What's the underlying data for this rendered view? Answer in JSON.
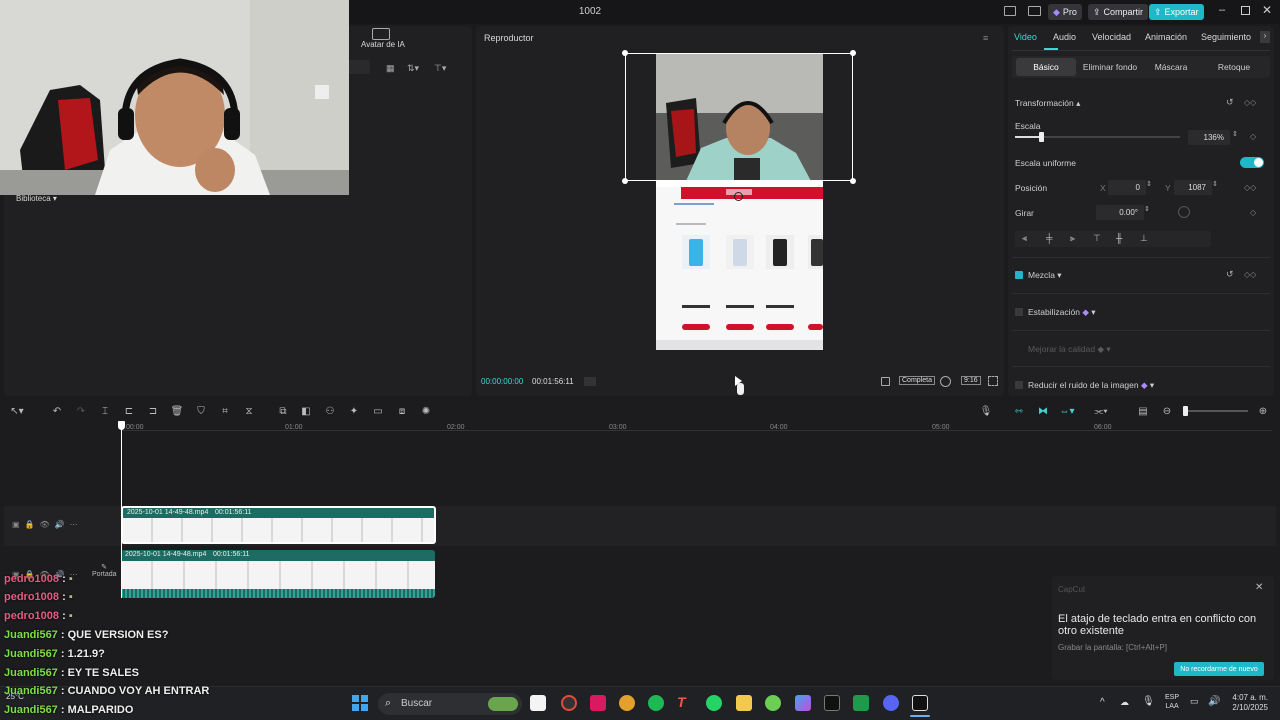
{
  "window": {
    "title": "1002",
    "pro_label": "Pro",
    "share_label": "Compartir",
    "export_label": "Exportar"
  },
  "media": {
    "ai_avatar_label": "Avatar de IA",
    "library_label": "Biblioteca"
  },
  "player": {
    "title": "Reproductor",
    "time_current": "00:00:00:00",
    "time_total": "00:01:56:11",
    "complete_label": "Completa",
    "ratio_label": "9:16"
  },
  "props": {
    "tabs": [
      "Video",
      "Audio",
      "Velocidad",
      "Animación",
      "Seguimiento"
    ],
    "subtabs": [
      "Básico",
      "Eliminar fondo",
      "Máscara",
      "Retoque"
    ],
    "transform_label": "Transformación",
    "scale_label": "Escala",
    "scale_value": "136%",
    "scale_fraction": 0.16,
    "uniform_label": "Escala uniforme",
    "position_label": "Posición",
    "x_label": "X",
    "x_value": "0",
    "y_label": "Y",
    "y_value": "1087",
    "rotate_label": "Girar",
    "rotate_value": "0.00°",
    "blend_label": "Mezcla",
    "stabilize_label": "Estabilización",
    "quality_label": "Mejorar la calidad",
    "noise_label": "Reducir el ruido de la imagen"
  },
  "timeline": {
    "ruler": [
      "00:00",
      "01:00",
      "02:00",
      "03:00",
      "04:00",
      "05:00",
      "06:00"
    ],
    "clip1_name": "2025-10-01 14-49-48.mp4",
    "clip1_duration": "00:01:56:11",
    "clip2_name": "2025-10-01 14-49-48.mp4",
    "clip2_duration": "00:01:56:11",
    "cover_label": "Portada"
  },
  "toast": {
    "app": "CapCut",
    "message": "El atajo de teclado entra en conflicto con otro existente",
    "detail": "Grabar la pantalla: [Ctrl+Alt+P]",
    "button": "No recordarme de nuevo"
  },
  "chat": [
    {
      "user": "pedro1008",
      "msg": ""
    },
    {
      "user": "pedro1008",
      "msg": ""
    },
    {
      "user": "pedro1008",
      "msg": ""
    },
    {
      "user": "Juandi567",
      "msg": "QUE VERSION ES?"
    },
    {
      "user": "Juandi567",
      "msg": "1.21.9?"
    },
    {
      "user": "Juandi567",
      "msg": "EY TE SALES"
    },
    {
      "user": "Juandi567",
      "msg": "CUANDO VOY AH ENTRAR"
    },
    {
      "user": "Juandi567",
      "msg": "MALPARIDO"
    }
  ],
  "taskbar": {
    "weather": "25°C",
    "search_placeholder": "Buscar",
    "lang_top": "ESP",
    "lang_bottom": "LAA",
    "time": "4:07 a. m.",
    "date": "2/10/2025"
  },
  "colors": {
    "accent": "#1fb8c8",
    "clip": "#1e6b63",
    "playhead": "#ffffff"
  }
}
